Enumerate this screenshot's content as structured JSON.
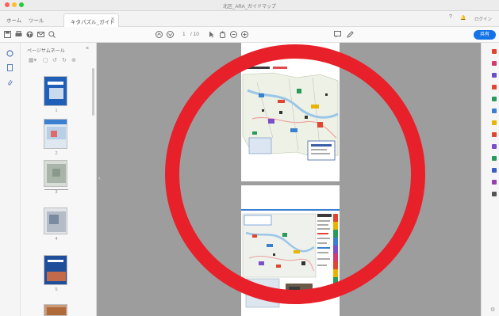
{
  "window": {
    "title": "北区_ARA_ガイドマップ",
    "traffic_colors": [
      "#ff5f57",
      "#febc2e",
      "#28c840"
    ]
  },
  "menu": {
    "home": "ホーム",
    "tools": "ツール"
  },
  "tab": {
    "label": "キタパズル_ガイド地図(A)",
    "close": "×"
  },
  "tabbar_right": {
    "help": "?",
    "bell": "🔔",
    "signin": "ログイン"
  },
  "toolbar": {
    "left_icons": [
      "save-icon",
      "print-icon",
      "upload-icon",
      "mail-icon",
      "search-icon"
    ],
    "page_current": "1",
    "page_total": "/ 10",
    "share_label": "共有"
  },
  "thumbnails": {
    "title": "ページサムネール",
    "close": "×",
    "pages": [
      {
        "number": "1",
        "accent": "#1f5fb8"
      },
      {
        "number": "2",
        "accent": "#3a7fd0"
      },
      {
        "number": "3",
        "accent": "#8a9a8a"
      },
      {
        "number": "4",
        "accent": "#7a8aa0"
      },
      {
        "number": "5",
        "accent": "#1f4f9a"
      },
      {
        "number": "6",
        "accent": "#b06a3a"
      }
    ]
  },
  "tool_colors": [
    "#e0452f",
    "#d43a6a",
    "#6a4fc7",
    "#e0452f",
    "#2a9a5a",
    "#3a7fd0",
    "#e8b400",
    "#e0452f",
    "#7a4fc7",
    "#2a9a5a",
    "#3a5fc7",
    "#9a3fb0",
    "#555555"
  ],
  "annotation": {
    "color": "#e8202a"
  }
}
